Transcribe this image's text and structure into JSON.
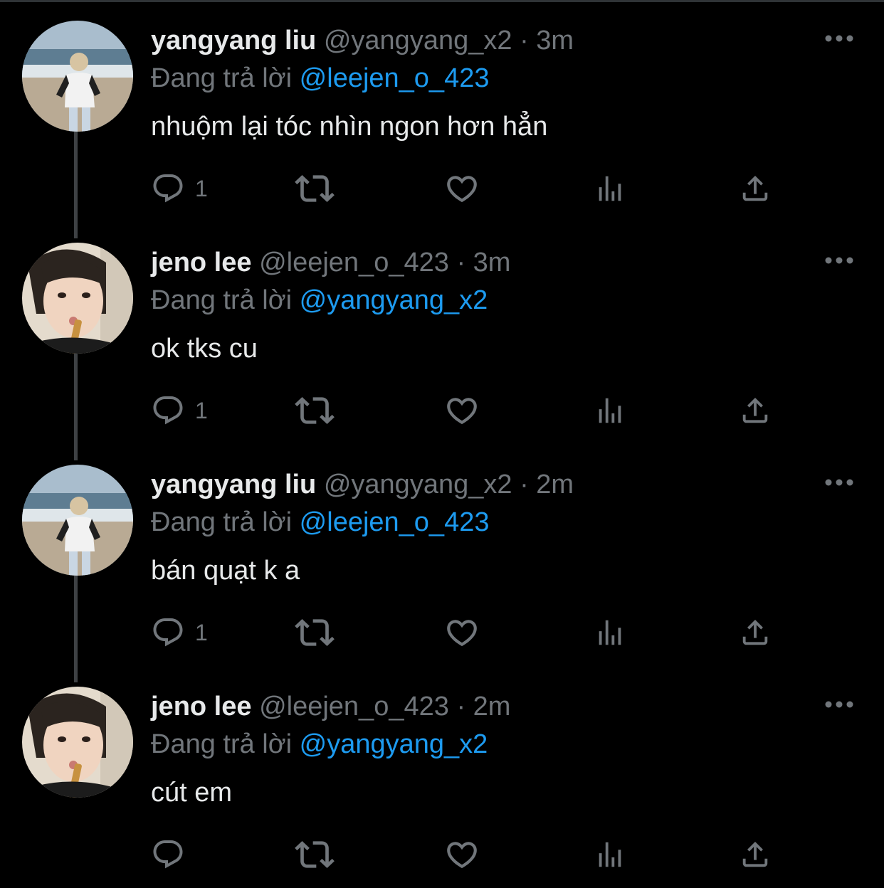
{
  "thread": {
    "replying_prefix": "Đang trả lời",
    "tweets": [
      {
        "display_name": "yangyang liu",
        "handle": "@yangyang_x2",
        "separator": "·",
        "time": "3m",
        "replying_to": "@leejen_o_423",
        "text": "nhuộm lại tóc nhìn ngon hơn hẳn",
        "reply_count": "1",
        "avatar_icon": "avatar-beach-photo"
      },
      {
        "display_name": "jeno lee",
        "handle": "@leejen_o_423",
        "separator": "·",
        "time": "3m",
        "replying_to": "@yangyang_x2",
        "text": "ok tks cu",
        "reply_count": "1",
        "avatar_icon": "avatar-selfie-photo"
      },
      {
        "display_name": "yangyang liu",
        "handle": "@yangyang_x2",
        "separator": "·",
        "time": "2m",
        "replying_to": "@leejen_o_423",
        "text": "bán quạt k a",
        "reply_count": "1",
        "avatar_icon": "avatar-beach-photo"
      },
      {
        "display_name": "jeno lee",
        "handle": "@leejen_o_423",
        "separator": "·",
        "time": "2m",
        "replying_to": "@yangyang_x2",
        "text": "cút em",
        "reply_count": "",
        "avatar_icon": "avatar-selfie-photo"
      }
    ]
  },
  "icons": {
    "reply": "reply-icon",
    "retweet": "retweet-icon",
    "like": "heart-icon",
    "views": "analytics-icon",
    "share": "share-icon",
    "more": "more-icon"
  },
  "colors": {
    "background": "#000000",
    "text_primary": "#e7e9ea",
    "text_secondary": "#71767b",
    "accent": "#1d9bf0",
    "thread_line": "#3e4144"
  }
}
